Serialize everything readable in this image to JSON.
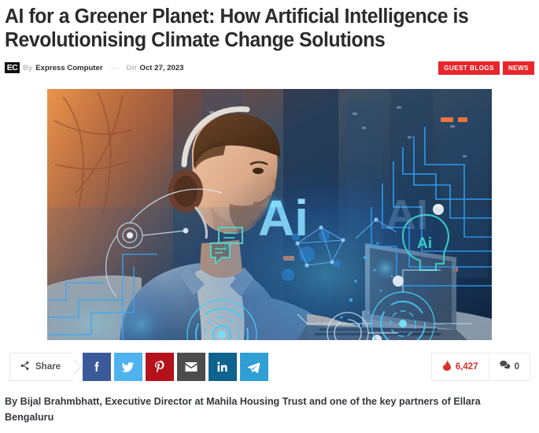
{
  "article": {
    "headline": "AI for a Greener Planet: How Artificial Intelligence is Revolutionising Climate Change Solutions",
    "lede": "By Bijal Brahmbhatt, Executive Director at Mahila Housing Trust and one of the key partners of Ellara Bengaluru"
  },
  "meta": {
    "logo_text": "EC",
    "by_label": "By",
    "author": "Express Computer",
    "separator": "—",
    "on_label": "On",
    "date": "Oct 27, 2023",
    "tags": [
      {
        "label": "GUEST BLOGS",
        "color": "#e8262b"
      },
      {
        "label": "NEWS",
        "color": "#e8262b"
      }
    ]
  },
  "hero": {
    "alt": "Man with headphones working on a laptop overlaid with blue AI network graphics",
    "overlay_big_text": "Ai",
    "overlay_head_text": "Ai",
    "palette": {
      "deep_navy": "#0d1d33",
      "electric_blue": "#1b7fe0",
      "cyan": "#4fd8e8",
      "warm_orange": "#c9653a",
      "denim": "#6f8ba8"
    }
  },
  "share": {
    "label": "Share",
    "icon": "share-nodes-icon",
    "networks": [
      {
        "name": "facebook",
        "glyph": "f",
        "color": "#3b5a9a"
      },
      {
        "name": "twitter",
        "glyph": "t",
        "color": "#4eb3ee"
      },
      {
        "name": "pinterest",
        "glyph": "p",
        "color": "#b5121b"
      },
      {
        "name": "email",
        "glyph": "e",
        "color": "#4c4c4c"
      },
      {
        "name": "linkedin",
        "glyph": "in",
        "color": "#0f638f"
      },
      {
        "name": "telegram",
        "glyph": "tg",
        "color": "#2f9fd4"
      }
    ]
  },
  "counters": {
    "views": {
      "icon": "flame-icon",
      "value": "6,427",
      "color": "#d8322c"
    },
    "comments": {
      "icon": "comment-icon",
      "value": "0",
      "color": "#4a4a4a"
    }
  }
}
